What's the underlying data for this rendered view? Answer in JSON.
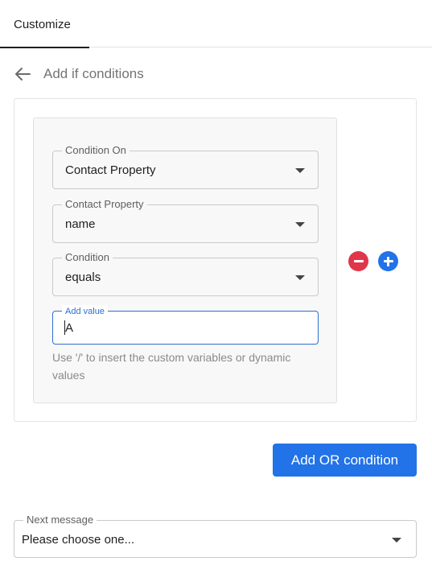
{
  "tabs": [
    {
      "label": "Customize",
      "active": true
    }
  ],
  "header": {
    "title": "Add if conditions",
    "back_icon": "arrow-left-icon"
  },
  "condition_group": {
    "fields": {
      "condition_on": {
        "label": "Condition On",
        "value": "Contact Property"
      },
      "contact_property": {
        "label": "Contact Property",
        "value": "name"
      },
      "condition": {
        "label": "Condition",
        "value": "equals"
      },
      "add_value": {
        "label": "Add value",
        "value": "A"
      }
    },
    "helper_text": "Use '/' to insert the custom variables or dynamic values",
    "remove_icon": "minus-circle-icon",
    "add_icon": "plus-circle-icon"
  },
  "add_or_button": {
    "label": "Add OR condition"
  },
  "next_message": {
    "label": "Next message",
    "value": "Please choose one..."
  },
  "colors": {
    "accent": "#2272e8",
    "danger": "#e0364a",
    "focus": "#2b6fce"
  }
}
